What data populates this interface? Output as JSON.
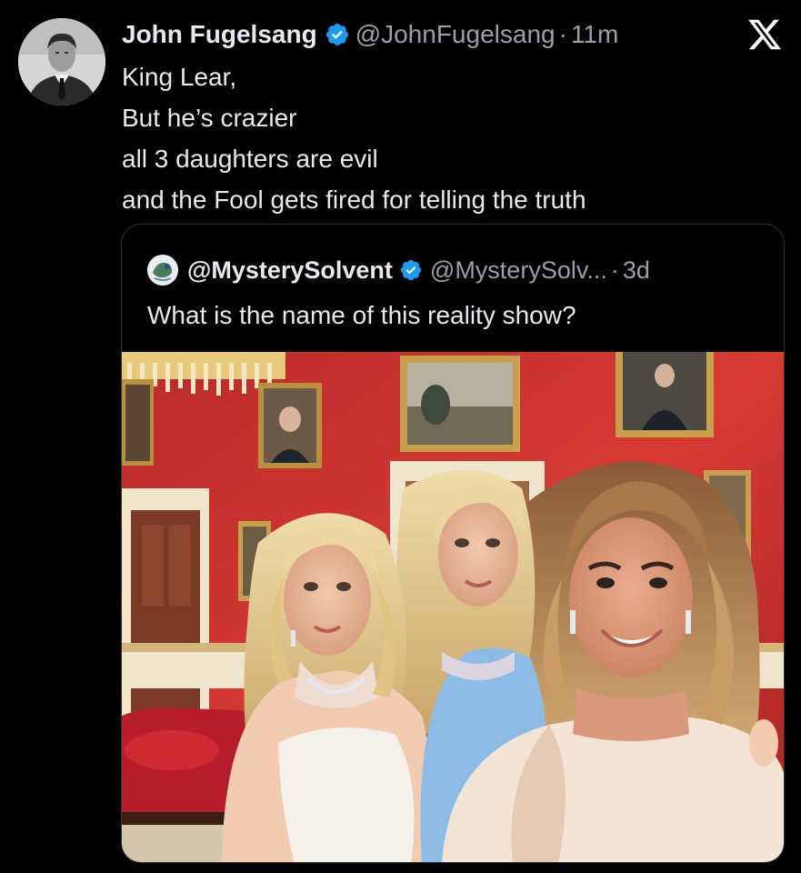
{
  "tweet": {
    "author": {
      "display_name": "John Fugelsang",
      "handle": "@JohnFugelsang",
      "verified": true
    },
    "separator": "·",
    "time": "11m",
    "lines": [
      "King Lear,",
      "But he’s crazier",
      "all 3 daughters are evil",
      "and the Fool gets fired for telling the truth"
    ]
  },
  "quote": {
    "author": {
      "display_name": "@MysterySolvent",
      "handle": "@MysterySolv...",
      "verified": true
    },
    "separator": "·",
    "time": "3d",
    "text": "What is the name of this reality show?"
  },
  "icons": {
    "verified": "verified-badge-icon",
    "brand": "x-logo-icon"
  },
  "colors": {
    "background": "#000000",
    "text_primary": "#e7e9ea",
    "text_secondary": "#9aa0a6",
    "verified_blue": "#1d9bf0",
    "border": "#2f3336",
    "photo_wall_red": "#c8302c"
  }
}
